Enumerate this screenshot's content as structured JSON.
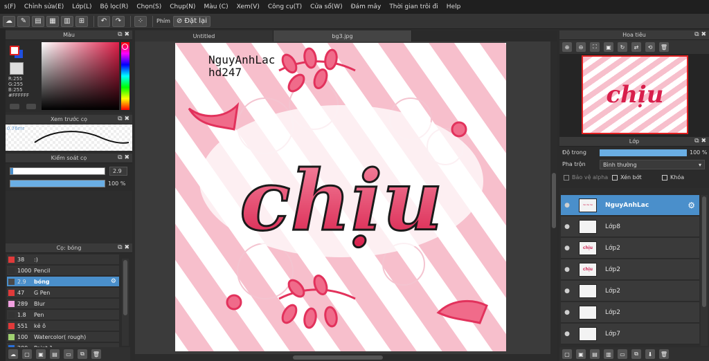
{
  "menu": [
    "s(F)",
    "Chỉnh sửa(E)",
    "Lớp(L)",
    "Bộ lọc(R)",
    "Chọn(S)",
    "Chụp(N)",
    "Màu (C)",
    "Xem(V)",
    "Công cụ(T)",
    "Cửa sổ(W)",
    "Đám mây",
    "Thời gian trôi đi",
    "Help"
  ],
  "toolbar": {
    "phim_label": "Phím",
    "reset_label": "Đặt lại"
  },
  "color_panel": {
    "title": "Màu",
    "r": "R:255",
    "g": "G:255",
    "b": "B:255",
    "hex": "#FFFFFF"
  },
  "brush_preview": {
    "title": "Xem trước cọ",
    "size": "0.76mr"
  },
  "brush_control": {
    "title": "Kiểm soát cọ",
    "size_value": "2.9",
    "opacity_value": "100 %"
  },
  "brush_list": {
    "title": "Cọ: bóng",
    "items": [
      {
        "size": "38",
        "name": ":)",
        "color": "#e03a3a"
      },
      {
        "size": "1000",
        "name": "Pencil",
        "color": "#333333"
      },
      {
        "size": "2.9",
        "name": "bóng",
        "color": "#4a4a4a"
      },
      {
        "size": "47",
        "name": "G Pen",
        "color": "#e03a3a"
      },
      {
        "size": "289",
        "name": "Blur",
        "color": "#f0a0e0"
      },
      {
        "size": "1.8",
        "name": "Pen",
        "color": "#333333"
      },
      {
        "size": "551",
        "name": "kẻ ô",
        "color": "#e03a3a"
      },
      {
        "size": "100",
        "name": "Watercolor( rough)",
        "color": "#9fd070"
      },
      {
        "size": "200",
        "name": "Paint 1",
        "color": "#2a6fd8"
      }
    ]
  },
  "tabs": [
    "Untitled",
    "bg3.jpg"
  ],
  "artwork": {
    "watermark_line1": "NguyAnhLac",
    "watermark_line2": "hd247",
    "word": "chịu"
  },
  "navigator": {
    "title": "Hoa tiêu"
  },
  "layers": {
    "title": "Lớp",
    "opacity_label": "Độ trong",
    "opacity_value": "100 %",
    "blend_label": "Pha trộn",
    "blend_value": "Bình thường",
    "protect_alpha": "Bảo vệ alpha",
    "clipping": "Xén bớt",
    "lock": "Khóa",
    "items": [
      {
        "name": "NguyAnhLac",
        "thumb": "~~~"
      },
      {
        "name": "Lớp8",
        "thumb": ""
      },
      {
        "name": "Lớp2",
        "thumb": "chịu"
      },
      {
        "name": "Lớp2",
        "thumb": "chịu"
      },
      {
        "name": "Lớp2",
        "thumb": ""
      },
      {
        "name": "Lớp2",
        "thumb": ""
      },
      {
        "name": "Lớp7",
        "thumb": ""
      }
    ]
  }
}
